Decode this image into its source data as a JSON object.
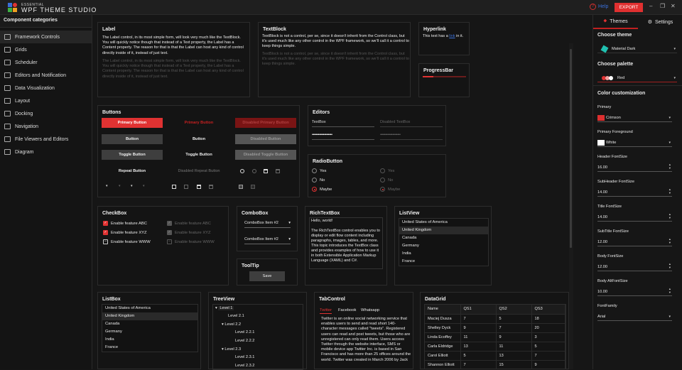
{
  "app": {
    "brand_small": "ESSENTIAL",
    "brand_large": "WPF THEME STUDIO",
    "help_label": "Help",
    "export_label": "EXPORT",
    "minimize_glyph": "–",
    "restore_glyph": "❐",
    "close_glyph": "✕",
    "accent": "#e03232"
  },
  "sidebar": {
    "header": "Component categories",
    "items": [
      {
        "label": "Framework Controls",
        "icon": "monitor-icon",
        "active": true
      },
      {
        "label": "Grids",
        "icon": "grid-icon"
      },
      {
        "label": "Scheduler",
        "icon": "calendar-icon"
      },
      {
        "label": "Editors and Notification",
        "icon": "editor-icon"
      },
      {
        "label": "Data Visualization",
        "icon": "chart-icon"
      },
      {
        "label": "Layout",
        "icon": "layout-icon"
      },
      {
        "label": "Docking",
        "icon": "docking-icon"
      },
      {
        "label": "Navigation",
        "icon": "navigation-icon"
      },
      {
        "label": "File Viewers and Editors",
        "icon": "file-icon"
      },
      {
        "label": "Diagram",
        "icon": "diagram-icon"
      }
    ]
  },
  "label_card": {
    "title": "Label",
    "text": "The Label control, in its most simple form, will look very much like the TextBlock. You will quickly notice though that instead of a Text property, the Label has a Content property. The reason for that is that the Label can host any kind of control directly inside of it, instead of just text.",
    "text_disabled": "The Label control, in its most simple form, will look very much like the TextBlock. You will quickly notice though that instead of a Text property, the Label has a Content property. The reason for that is that the Label can host any kind of control directly inside of it, instead of just text."
  },
  "textblock_card": {
    "title": "TextBlock",
    "text": "TextBlock is not a control, per se, since it doesn't inherit from the Control class, but it's used much like any other control in the WPF framework, so we'll call it a control to keep things simple.",
    "text_disabled": "TextBlock is not a control, per se, since it doesn't inherit from the Control class, but it's used much like any other control in the WPF framework, so we'll call it a control to keep things simple."
  },
  "hyperlink_card": {
    "title": "Hyperlink",
    "before": "This text has a ",
    "link": "link",
    "after": " in it."
  },
  "progress_card": {
    "title": "ProgressBar",
    "value_percent": 25
  },
  "buttons_card": {
    "title": "Buttons",
    "primary": "Primary Button",
    "primary_flat": "Primary Button",
    "primary_disabled": "Disabled Primary Button",
    "button": "Button",
    "button_flat": "Button",
    "button_disabled": "Disabled Button",
    "toggle": "Toggle Button",
    "toggle_flat": "Toggle Button",
    "toggle_disabled": "Disabled Toggle Button",
    "repeat": "Repeat Button",
    "repeat_disabled": "Disabled Repeat Button"
  },
  "editors_card": {
    "title": "Editors",
    "textbox_value": "TextBox",
    "textbox_disabled_value": "Disabled TextBox",
    "password_value": "••••••••••••••••••••",
    "password_disabled_value": "••••••••••••••••••••"
  },
  "radio_card": {
    "title": "RadioButton",
    "options": [
      "Yes",
      "No",
      "Maybe"
    ],
    "selected": "Maybe"
  },
  "checkbox_card": {
    "title": "CheckBox",
    "items": [
      {
        "label": "Enable feature ABC",
        "state": "checked"
      },
      {
        "label": "Enable feature XYZ",
        "state": "checked"
      },
      {
        "label": "Enable feature WWW",
        "state": "indeterminate"
      }
    ]
  },
  "combobox_card": {
    "title": "ComboBox",
    "value1": "ComboBox Item #2",
    "value2": "ComboBox Item #2"
  },
  "tooltip_card": {
    "title": "ToolTip",
    "button": "Save"
  },
  "richtext_card": {
    "title": "RichTextBox",
    "line1": "Hello, world!",
    "body": "The RichTextBox control enables you to display or edit flow content including paragraphs, images, tables, and more. This topic introduces the TextBox class and provides examples of how to use it in both Extensible Application Markup Language (XAML) and C#."
  },
  "listview_card": {
    "title": "ListView",
    "items": [
      "United States of America",
      "United Kingdom",
      "Canada",
      "Germany",
      "India",
      "France"
    ],
    "selected_index": 1
  },
  "listbox_card": {
    "title": "ListBox",
    "items": [
      "United States of America",
      "United Kingdom",
      "Canada",
      "Germany",
      "India",
      "France"
    ],
    "selected_index": 1
  },
  "treeview_card": {
    "title": "TreeView",
    "nodes": [
      {
        "label": "Level 1",
        "depth": 0,
        "expanded": true
      },
      {
        "label": "Level 2.1",
        "depth": 1
      },
      {
        "label": "Level 2.2",
        "depth": 1,
        "expanded": true
      },
      {
        "label": "Level 2.2.1",
        "depth": 2
      },
      {
        "label": "Level 2.2.2",
        "depth": 2
      },
      {
        "label": "Level 2.3",
        "depth": 1,
        "expanded": true
      },
      {
        "label": "Level 2.3.1",
        "depth": 2
      },
      {
        "label": "Level 2.3.2",
        "depth": 2
      }
    ]
  },
  "tabcontrol_card": {
    "title": "TabControl",
    "tabs": [
      "Twitter",
      "Facebook",
      "Whatsapp"
    ],
    "active_tab": "Twitter",
    "content": "Twitter is an online social networking service that enables users to send and read short 140-character messages called \"tweets\". Registered users can read and post tweets, but those who are unregistered can only read them. Users access Twitter through the website interface, SMS or mobile device app Twitter Inc. is based in San Francisco and has more than 25 offices around the world. Twitter was created in March 2006 by Jack"
  },
  "datagrid_card": {
    "title": "DataGrid",
    "columns": [
      "Name",
      "QS1",
      "QS2",
      "QS3"
    ],
    "rows": [
      [
        "Maciej Dusza",
        "7",
        "5",
        "18"
      ],
      [
        "Shelley Dyck",
        "9",
        "7",
        "20"
      ],
      [
        "Linda Ecoffey",
        "11",
        "9",
        "3"
      ],
      [
        "Carla Eldridge",
        "13",
        "11",
        "5"
      ],
      [
        "Carol Elliott",
        "5",
        "13",
        "7"
      ],
      [
        "Shannon Elliott",
        "7",
        "15",
        "9"
      ]
    ]
  },
  "right_panel": {
    "tab_themes": "Themes",
    "tab_settings": "Settings",
    "choose_theme": "Choose theme",
    "theme_value": "Material Dark",
    "choose_palette": "Choose palette",
    "palette_value": "Red",
    "color_customization": "Color customization",
    "primary_label": "Primary",
    "primary_value": "Crimson",
    "primary_color": "#dc2f2f",
    "primary_fg_label": "Primary Foreground",
    "primary_fg_value": "White",
    "primary_fg_color": "#ffffff",
    "font_fields": [
      {
        "label": "Header FontSize",
        "value": "16.00"
      },
      {
        "label": "SubHeader FontSize",
        "value": "14.00"
      },
      {
        "label": "Title FontSize",
        "value": "14.00"
      },
      {
        "label": "SubTitle FontSize",
        "value": "12.00"
      },
      {
        "label": "Body FontSize",
        "value": "12.00"
      },
      {
        "label": "Body AltFontSize",
        "value": "10.00"
      }
    ],
    "font_family_label": "FontFamily",
    "font_family_value": "Arial"
  }
}
